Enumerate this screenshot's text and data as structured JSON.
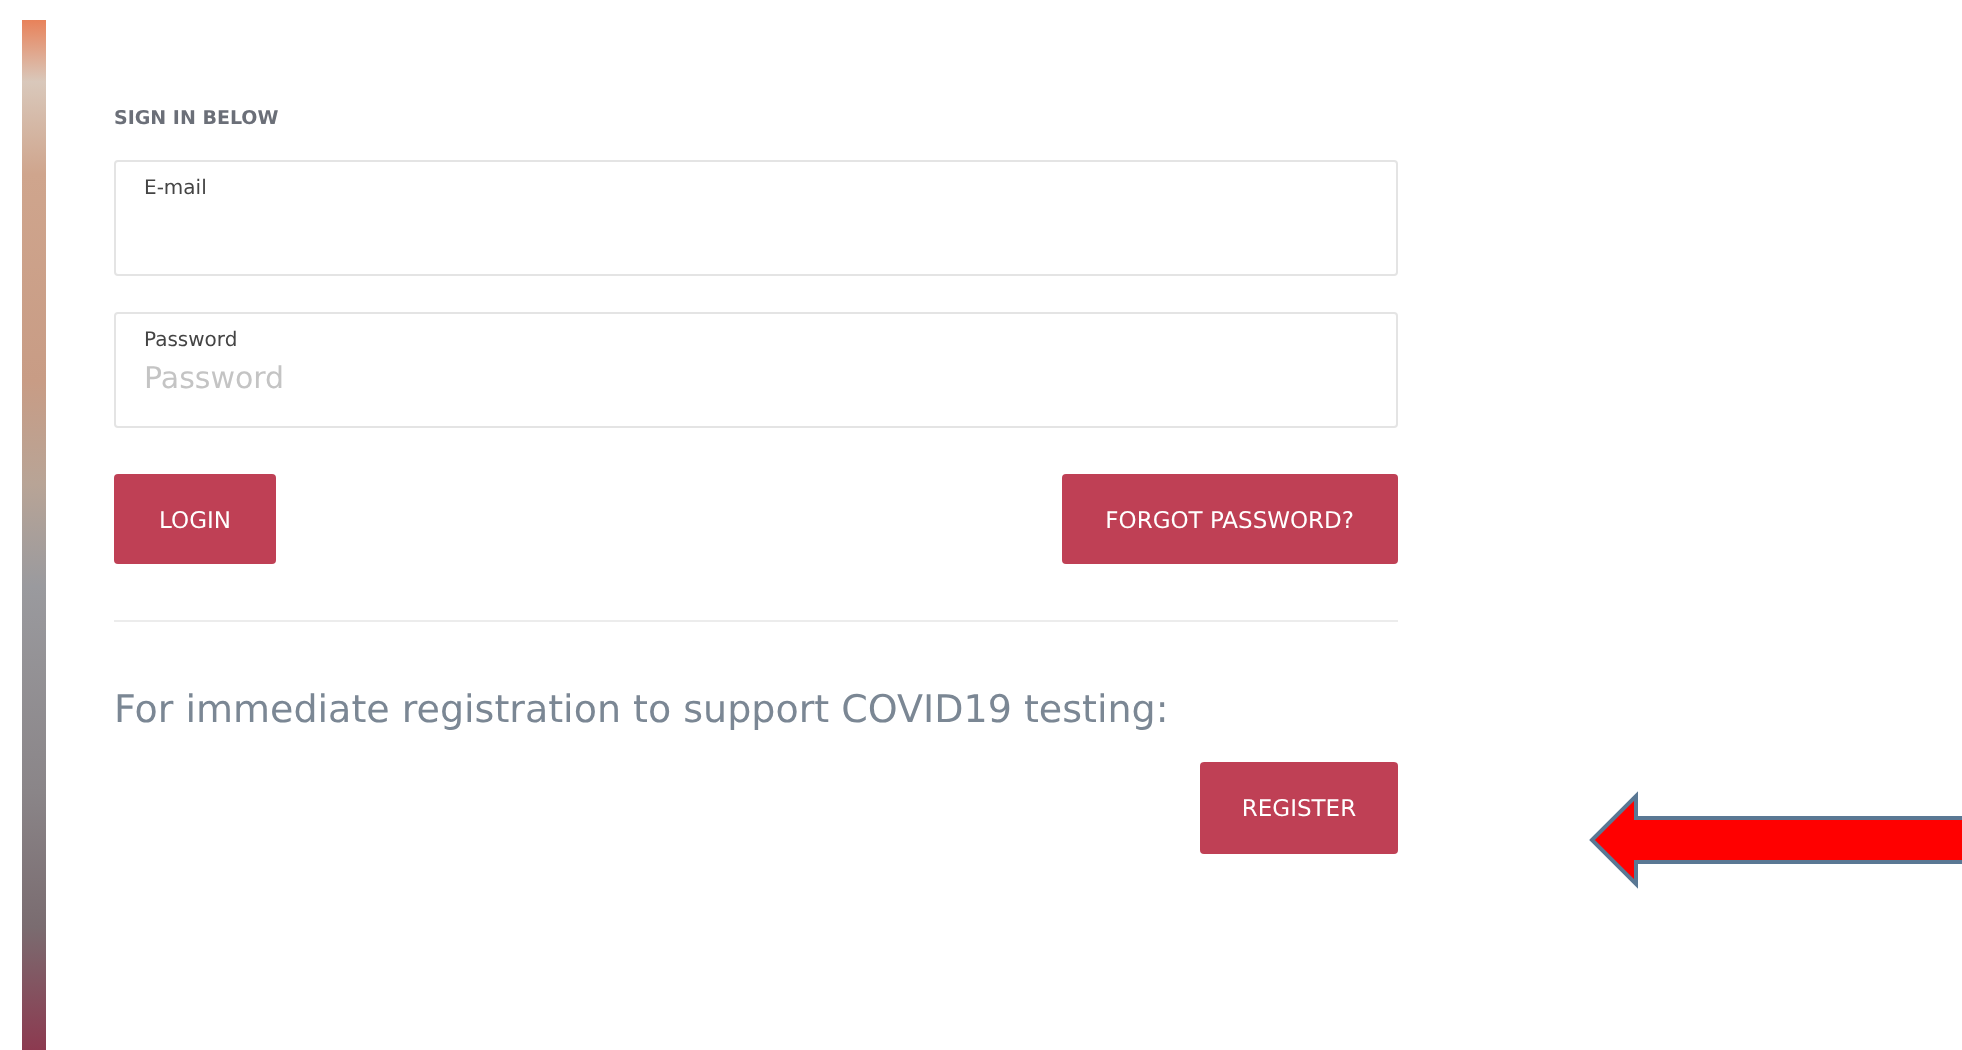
{
  "heading": "SIGN IN BELOW",
  "fields": [
    {
      "label": "E-mail"
    },
    {
      "label": "Password",
      "placeholder": "Password"
    }
  ],
  "buttons": [
    "LOGIN",
    "FORGOT PASSWORD?"
  ],
  "registration": {
    "text": "For immediate registration to support COVID19 testing:",
    "button": "REGISTER"
  }
}
